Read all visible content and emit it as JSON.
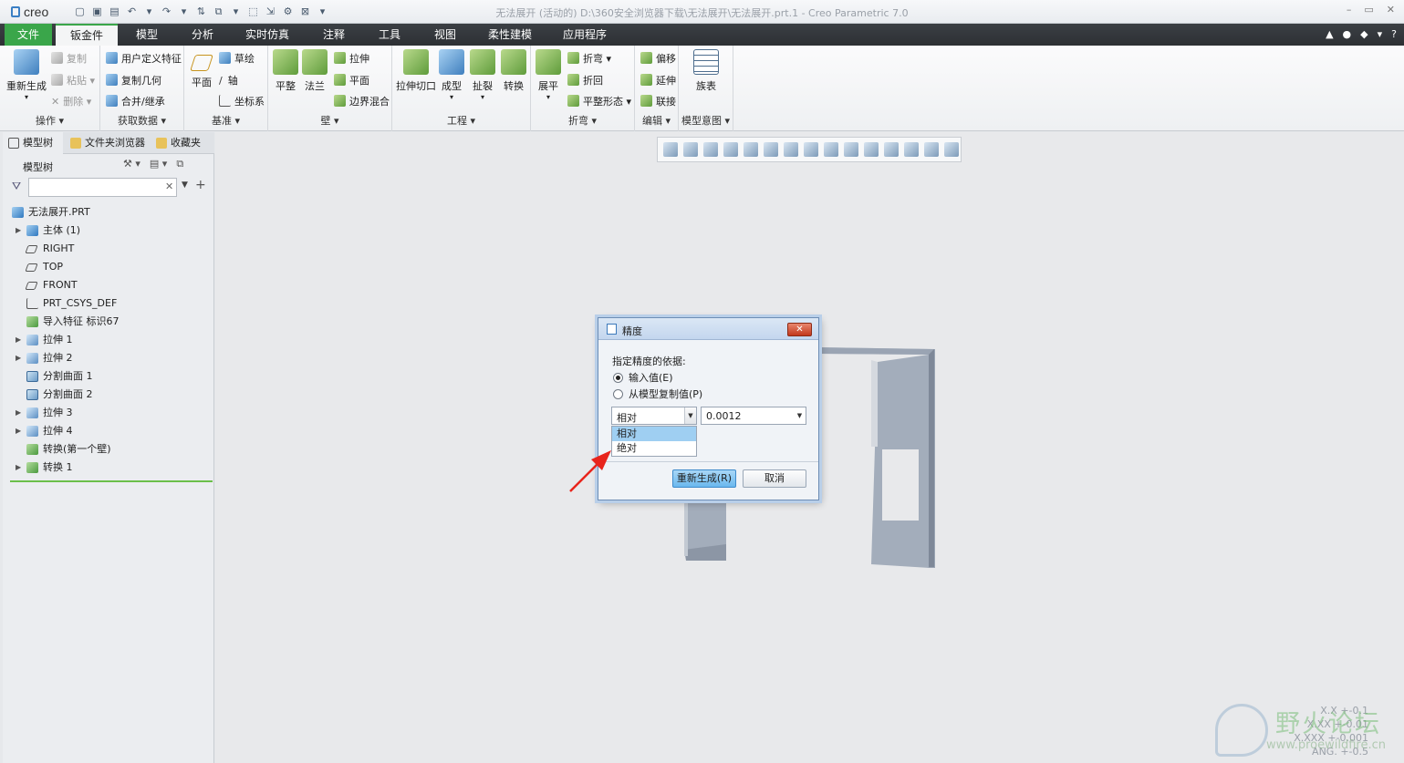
{
  "app": {
    "logo": "creo",
    "window_title": "无法展开 (活动的) D:\\360安全浏览器下载\\无法展开\\无法展开.prt.1 - Creo Parametric 7.0"
  },
  "tabs": [
    {
      "label": "文件"
    },
    {
      "label": "钣金件"
    },
    {
      "label": "模型"
    },
    {
      "label": "分析"
    },
    {
      "label": "实时仿真"
    },
    {
      "label": "注释"
    },
    {
      "label": "工具"
    },
    {
      "label": "视图"
    },
    {
      "label": "柔性建模"
    },
    {
      "label": "应用程序"
    }
  ],
  "ribbon": {
    "ops": {
      "label": "操作",
      "regen": "重新生成",
      "copy": "复制",
      "paste": "粘贴",
      "delete": "删除"
    },
    "data": {
      "label": "获取数据",
      "udf": "用户定义特征",
      "copygeom": "复制几何",
      "merge": "合并/继承"
    },
    "datum": {
      "label": "基准",
      "plane": "平面",
      "sketch": "草绘",
      "axis": "轴",
      "csys": "坐标系"
    },
    "wall": {
      "label": "壁",
      "flat": "平整",
      "flange": "法兰",
      "extrude": "拉伸",
      "planar": "平面",
      "blend": "边界混合"
    },
    "eng": {
      "label": "工程",
      "cut": "拉伸切口",
      "form": "成型",
      "rip": "扯裂",
      "convert": "转换"
    },
    "bend": {
      "label": "折弯",
      "unbend": "展平",
      "bend": "折弯",
      "bendback": "折回",
      "flatpattern": "平整形态"
    },
    "edit": {
      "label": "编辑",
      "offset": "偏移",
      "extend": "延伸",
      "join": "联接"
    },
    "intent": {
      "label": "模型意图",
      "table": "族表"
    }
  },
  "panel": {
    "tabs": [
      "模型树",
      "文件夹浏览器",
      "收藏夹"
    ],
    "tree_header": "模型树",
    "search_placeholder": "",
    "nodes": [
      {
        "label": "无法展开.PRT",
        "icon": "part",
        "indent": 0,
        "expand": ""
      },
      {
        "label": "主体 (1)",
        "icon": "part",
        "indent": 1,
        "expand": "▶"
      },
      {
        "label": "RIGHT",
        "icon": "plane",
        "indent": 1,
        "expand": ""
      },
      {
        "label": "TOP",
        "icon": "plane",
        "indent": 1,
        "expand": ""
      },
      {
        "label": "FRONT",
        "icon": "plane",
        "indent": 1,
        "expand": ""
      },
      {
        "label": "PRT_CSYS_DEF",
        "icon": "csys",
        "indent": 1,
        "expand": ""
      },
      {
        "label": "导入特征 标识67",
        "icon": "conv",
        "indent": 1,
        "expand": ""
      },
      {
        "label": "拉伸 1",
        "icon": "feat",
        "indent": 1,
        "expand": "▶"
      },
      {
        "label": "拉伸 2",
        "icon": "feat",
        "indent": 1,
        "expand": "▶"
      },
      {
        "label": "分割曲面 1",
        "icon": "surf",
        "indent": 1,
        "expand": ""
      },
      {
        "label": "分割曲面 2",
        "icon": "surf",
        "indent": 1,
        "expand": ""
      },
      {
        "label": "拉伸 3",
        "icon": "feat",
        "indent": 1,
        "expand": "▶"
      },
      {
        "label": "拉伸 4",
        "icon": "feat",
        "indent": 1,
        "expand": "▶"
      },
      {
        "label": "转换(第一个壁)",
        "icon": "conv",
        "indent": 1,
        "expand": ""
      },
      {
        "label": "转换 1",
        "icon": "conv",
        "indent": 1,
        "expand": "▶"
      }
    ]
  },
  "dialog": {
    "title": "精度",
    "prompt": "指定精度的依据:",
    "radio_input": "输入值(E)",
    "radio_copy": "从模型复制值(P)",
    "mode_value": "相对",
    "precision_value": "0.0012",
    "options": [
      "相对",
      "绝对"
    ],
    "regen_button": "重新生成(R)",
    "cancel_button": "取消"
  },
  "watermark": {
    "name": "野火论坛",
    "url": "www.proewildfire.cn"
  },
  "tolerance": {
    "line1": "X.X +-0.1",
    "line2": "X.XX +-0.01",
    "line3": "X.XXX +-0.001",
    "line4": "ANG. +-0.5"
  },
  "colors": {
    "accent_green": "#3aa64a",
    "tab_bar": "#2d3034",
    "model": "#a3adbb",
    "dialog_primary": "#6ab8ee",
    "arrow": "#e8241c"
  }
}
